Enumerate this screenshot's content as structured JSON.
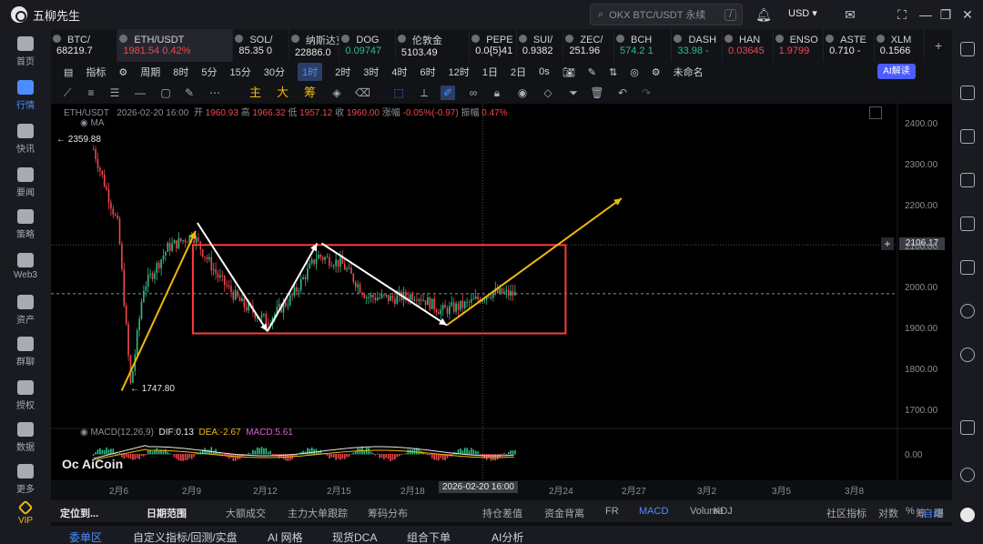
{
  "app": {
    "name": "五柳先生"
  },
  "search": {
    "placeholder": "OKX BTC/USDT 永续",
    "shortcut": "/"
  },
  "titlebar": {
    "currency": "USD"
  },
  "sidebar": [
    {
      "label": "首页",
      "icon": "home-icon"
    },
    {
      "label": "行情",
      "icon": "market-icon",
      "active": true
    },
    {
      "label": "快讯",
      "icon": "news-icon"
    },
    {
      "label": "要闻",
      "icon": "headline-icon"
    },
    {
      "label": "策略",
      "icon": "strategy-icon"
    },
    {
      "label": "Web3",
      "icon": "web3-icon"
    },
    {
      "label": "资产",
      "icon": "assets-icon"
    },
    {
      "label": "群聊",
      "icon": "chat-icon"
    },
    {
      "label": "授权",
      "icon": "auth-icon"
    },
    {
      "label": "数据",
      "icon": "data-icon"
    },
    {
      "label": "更多",
      "icon": "more-icon"
    },
    {
      "label": "VIP",
      "icon": "vip-icon"
    }
  ],
  "tickers": [
    {
      "name": "BTC/",
      "price": "68219.7",
      "dir": "neutral"
    },
    {
      "name": "ETH/USDT",
      "price": "1981.54  0.42%",
      "dir": "down",
      "selected": true
    },
    {
      "name": "SOL/",
      "price": "85.35  0",
      "dir": "neutral"
    },
    {
      "name": "纳斯达克l",
      "price": "22886.0",
      "dir": "neutral"
    },
    {
      "name": "DOG",
      "price": "0.09747",
      "dir": "up"
    },
    {
      "name": "伦敦金",
      "price": "5103.49",
      "dir": "neutral"
    },
    {
      "name": "PEPE",
      "price": "0.0{5}41",
      "dir": "neutral"
    },
    {
      "name": "SUI/",
      "price": "0.9382",
      "dir": "neutral"
    },
    {
      "name": "ZEC/",
      "price": "251.96",
      "dir": "neutral"
    },
    {
      "name": "BCH",
      "price": "574.2  1",
      "dir": "up"
    },
    {
      "name": "DASH",
      "price": "33.98  -",
      "dir": "up"
    },
    {
      "name": "HAN",
      "price": "0.03645",
      "dir": "down"
    },
    {
      "name": "ENSO",
      "price": "1.9799",
      "dir": "down"
    },
    {
      "name": "ASTE",
      "price": "0.710  -",
      "dir": "neutral"
    },
    {
      "name": "XLM",
      "price": "0.1566",
      "dir": "neutral"
    }
  ],
  "toolbar1": {
    "indicator": "指标",
    "period": "周期",
    "intervals": [
      "8时",
      "5分",
      "15分",
      "30分",
      "1时",
      "2时",
      "3时",
      "4时",
      "6时",
      "12时",
      "1日",
      "2日"
    ],
    "active_interval": "1时",
    "zero_s": "0s",
    "layout_name": "未命名",
    "ai_button": "AI解读"
  },
  "toolbar2": {
    "main": "主",
    "big": "大",
    "chip": "筹"
  },
  "chart_info": {
    "symbol": "ETH/USDT",
    "datetime": "2026-02-20 16:00",
    "open_label": "开",
    "open": "1960.93",
    "high_label": "高",
    "high": "1966.32",
    "low_label": "低",
    "low": "1957.12",
    "close_label": "收",
    "close": "1960.00",
    "change_label": "涨幅",
    "change": "-0.05%(-0.97)",
    "amp_label": "振幅",
    "amp": "0.47%",
    "ma_label": "MA"
  },
  "macd_info": {
    "label": "MACD(12,26,9)",
    "dif": "DIF:0.13",
    "dea": "DEA:-2.67",
    "macd": "MACD:5.61"
  },
  "chart_data": {
    "type": "candlestick",
    "symbol": "ETH/USDT",
    "y_ticks": [
      "2400.00",
      "2300.00",
      "2200.00",
      "2100.00",
      "2000.00",
      "1900.00",
      "1800.00",
      "1700.00"
    ],
    "ylim": [
      1700,
      2400
    ],
    "x_ticks": [
      "2月6",
      "2月9",
      "2月12",
      "2月15",
      "2月18",
      "2月24",
      "2月27",
      "3月2",
      "3月5",
      "3月8"
    ],
    "x_selected": "2026-02-20 16:00",
    "current_price_label": "2106.17",
    "macd_tick": "0.00",
    "annotations": {
      "high": "2359.88",
      "low": "1747.80"
    },
    "approx_path": [
      {
        "d": "2026-02-05",
        "p": 2340
      },
      {
        "d": "2026-02-06",
        "p": 2150
      },
      {
        "d": "2026-02-06T12",
        "p": 1760
      },
      {
        "d": "2026-02-07",
        "p": 2000
      },
      {
        "d": "2026-02-08",
        "p": 2100
      },
      {
        "d": "2026-02-09",
        "p": 2130
      },
      {
        "d": "2026-02-10",
        "p": 2030
      },
      {
        "d": "2026-02-11",
        "p": 1960
      },
      {
        "d": "2026-02-12",
        "p": 1920
      },
      {
        "d": "2026-02-13",
        "p": 1980
      },
      {
        "d": "2026-02-14",
        "p": 2080
      },
      {
        "d": "2026-02-15",
        "p": 2060
      },
      {
        "d": "2026-02-16",
        "p": 1980
      },
      {
        "d": "2026-02-17",
        "p": 1975
      },
      {
        "d": "2026-02-18",
        "p": 1985
      },
      {
        "d": "2026-02-19",
        "p": 1945
      },
      {
        "d": "2026-02-20",
        "p": 1960
      },
      {
        "d": "2026-02-21",
        "p": 1990
      },
      {
        "d": "2026-02-22",
        "p": 1985
      }
    ],
    "box": {
      "from": "2026-02-09",
      "to": "2026-02-24",
      "top": 2106,
      "bottom": 1890
    },
    "colors": {
      "up": "#2fbd85",
      "down": "#f0474f",
      "arrow_yellow": "#f0b90b",
      "box": "#ff3b3b",
      "arrow_white": "#ffffff"
    }
  },
  "watermark": "AiCoin",
  "bottom_tabs1": [
    "定位到...",
    "日期范围",
    "大额成交",
    "主力大单跟踪",
    "筹码分布",
    "持仓差值",
    "资金背离",
    "FR",
    "MACD",
    "Volume",
    "KDJ",
    "社区指标",
    "对数",
    "%",
    "自动"
  ],
  "bottom_right": {
    "a": "筹",
    "b": "爆"
  },
  "bottom_tabs2": [
    "委单区",
    "自定义指标/回测/实盘",
    "AI 网格",
    "现货DCA",
    "组合下单",
    "AI分析"
  ]
}
